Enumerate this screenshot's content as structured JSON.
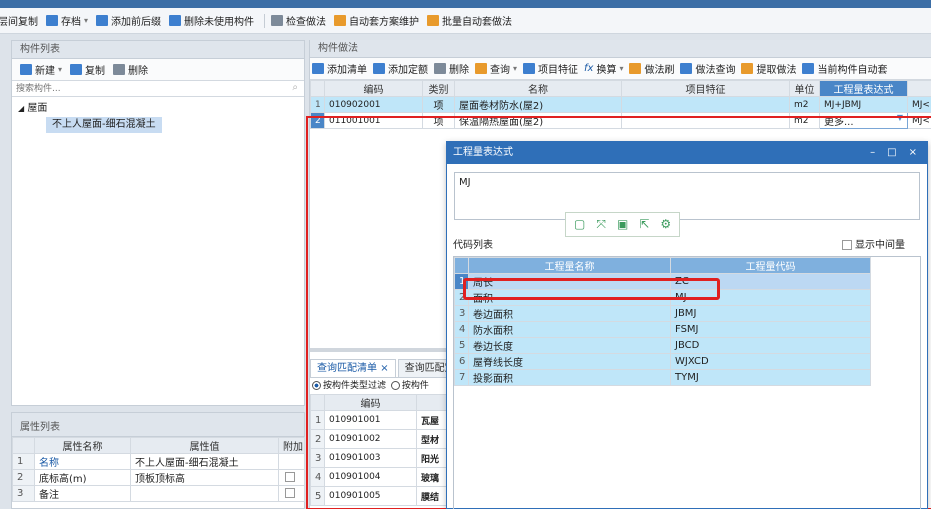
{
  "toolbar": {
    "items": [
      {
        "label": "层间复制",
        "icon": "layer-copy-icon",
        "color": "blue",
        "caret": false
      },
      {
        "label": "存档",
        "icon": "archive-icon",
        "color": "blue",
        "caret": true
      },
      {
        "label": "添加前后缀",
        "icon": "add-prefix-suffix-icon",
        "color": "blue",
        "caret": false
      },
      {
        "label": "删除未使用构件",
        "icon": "delete-unused-icon",
        "color": "blue",
        "caret": false
      },
      {
        "label": "检查做法",
        "icon": "check-method-icon",
        "color": "gray",
        "caret": false
      },
      {
        "label": "自动套方案维护",
        "icon": "auto-scheme-icon",
        "color": "orange",
        "caret": false
      },
      {
        "label": "批量自动套做法",
        "icon": "batch-auto-icon",
        "color": "orange",
        "caret": false
      }
    ]
  },
  "left": {
    "component_list_title": "构件列表",
    "new_label": "新建",
    "copy_label": "复制",
    "delete_label": "删除",
    "search_placeholder": "搜索构件...",
    "tree_root": "屋面",
    "tree_child": "不上人屋面-细石混凝土",
    "prop_title": "属性列表",
    "prop_headers": [
      "属性名称",
      "属性值",
      "附加"
    ],
    "props": [
      {
        "n": "1",
        "name": "名称",
        "value": "不上人屋面-细石混凝土"
      },
      {
        "n": "2",
        "name": "底标高(m)",
        "value": "顶板顶标高"
      },
      {
        "n": "3",
        "name": "备注",
        "value": ""
      }
    ]
  },
  "right": {
    "title": "构件做法",
    "toolbar": [
      "添加清单",
      "添加定额",
      "删除",
      "查询",
      "项目特征",
      "换算",
      "做法刷",
      "做法查询",
      "提取做法",
      "当前构件自动套"
    ],
    "headers": [
      "编码",
      "类别",
      "名称",
      "项目特征",
      "单位",
      "工程量表达式"
    ],
    "rows": [
      {
        "n": "1",
        "code": "010902001",
        "type": "项",
        "name": "屋面卷材防水(屋2)",
        "feature": "",
        "unit": "m2",
        "expr": "MJ+JBMJ",
        "extra": "MJ<"
      },
      {
        "n": "2",
        "code": "011001001",
        "type": "项",
        "name": "保温隔热屋面(屋2)",
        "feature": "",
        "unit": "m2",
        "expr": "更多...",
        "extra": "MJ<"
      }
    ]
  },
  "query": {
    "tab1": "查询匹配清单",
    "tab1_close": "×",
    "tab2": "查询匹配定",
    "filter1": "按构件类型过滤",
    "filter2": "按构件",
    "header": "编码",
    "rows": [
      {
        "n": "1",
        "code": "010901001",
        "name": "瓦屋"
      },
      {
        "n": "2",
        "code": "010901002",
        "name": "型材"
      },
      {
        "n": "3",
        "code": "010901003",
        "name": "阳光"
      },
      {
        "n": "4",
        "code": "010901004",
        "name": "玻璃"
      },
      {
        "n": "5",
        "code": "010901005",
        "name": "膜结"
      }
    ]
  },
  "dialog": {
    "title": "工程量表达式",
    "minimize": "–",
    "maximize": "□",
    "close": "×",
    "expression": "MJ",
    "code_list_label": "代码列表",
    "show_intermediate": "显示中间量",
    "headers": [
      "工程量名称",
      "工程量代码"
    ],
    "rows": [
      {
        "n": "1",
        "name": "周长",
        "code": "ZC"
      },
      {
        "n": "2",
        "name": "面积",
        "code": "MJ"
      },
      {
        "n": "3",
        "name": "卷边面积",
        "code": "JBMJ"
      },
      {
        "n": "4",
        "name": "防水面积",
        "code": "FSMJ"
      },
      {
        "n": "5",
        "name": "卷边长度",
        "code": "JBCD"
      },
      {
        "n": "6",
        "name": "屋脊线长度",
        "code": "WJXCD"
      },
      {
        "n": "7",
        "name": "投影面积",
        "code": "TYMJ"
      }
    ]
  }
}
